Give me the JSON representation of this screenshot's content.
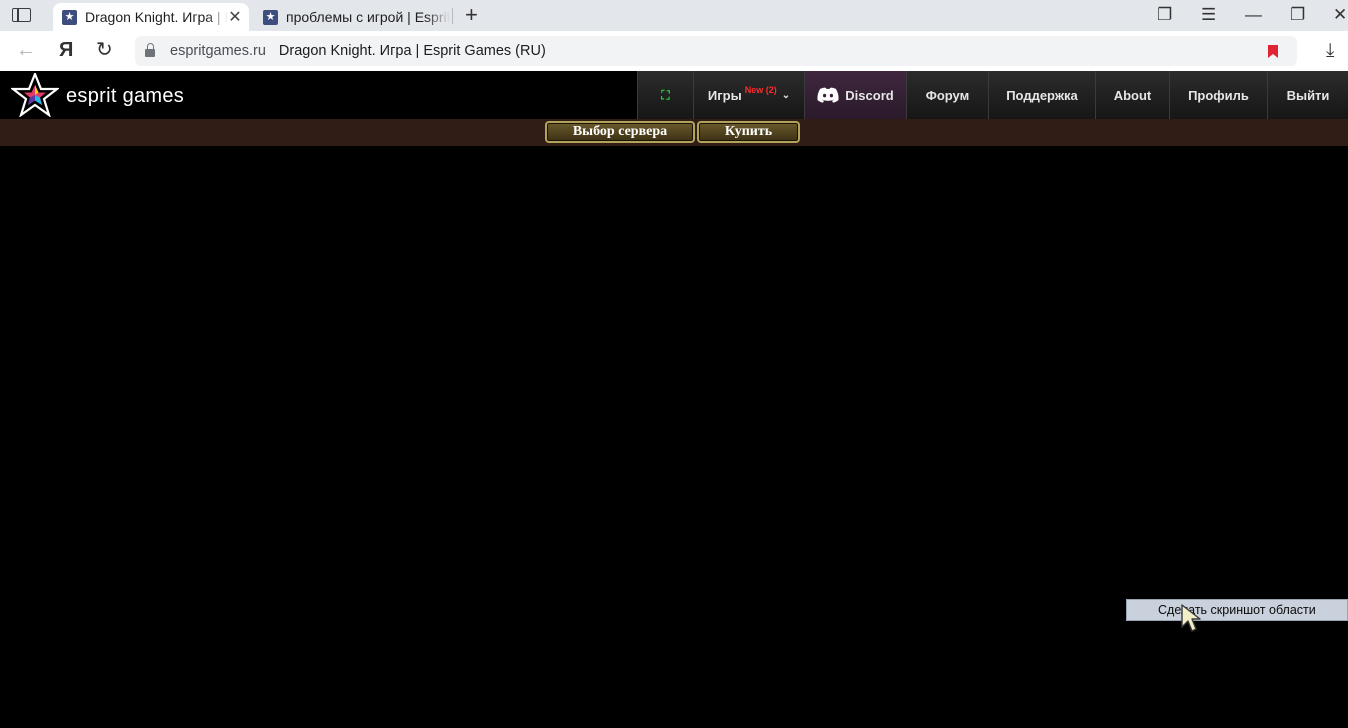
{
  "browser": {
    "tabs": [
      {
        "title": "Dragon Knight. Игра | Esprit Games (RU)",
        "active": true
      },
      {
        "title": "проблемы с игрой | Esprit Games",
        "active": false
      }
    ],
    "address": {
      "domain": "espritgames.ru",
      "page_title": "Dragon Knight. Игра | Esprit Games (RU)"
    },
    "icons": {
      "sidebar": "sidebar-icon",
      "tab_favicon": "★",
      "tab_close": "✕",
      "new_tab": "+",
      "collections": "❐",
      "menu": "☰",
      "minimize": "—",
      "restore": "❐",
      "close": "✕",
      "back": "←",
      "yandex": "Я",
      "reload": "↻",
      "download": "⤓"
    }
  },
  "site": {
    "logo_text": "esprit games",
    "nav": {
      "fullscreen_icon": "⛶",
      "games": "Игры",
      "games_badge": "New",
      "games_count": "(2)",
      "games_caret": "⌄",
      "discord": "Discord",
      "forum": "Форум",
      "support": "Поддержка",
      "about": "About",
      "profile": "Профиль",
      "logout": "Выйти"
    },
    "subbar": {
      "server_select": "Выбор сервера",
      "buy": "Купить"
    }
  },
  "context_menu": {
    "item": "Сделать скриншот области"
  },
  "colors": {
    "page_bg": "#000000",
    "subbar_bg": "#2f1d16",
    "button_border": "#b3a25a",
    "badge_red": "#ff2b2b",
    "bookmark_red": "#e02434",
    "fullscreen_green": "#27d13b"
  }
}
